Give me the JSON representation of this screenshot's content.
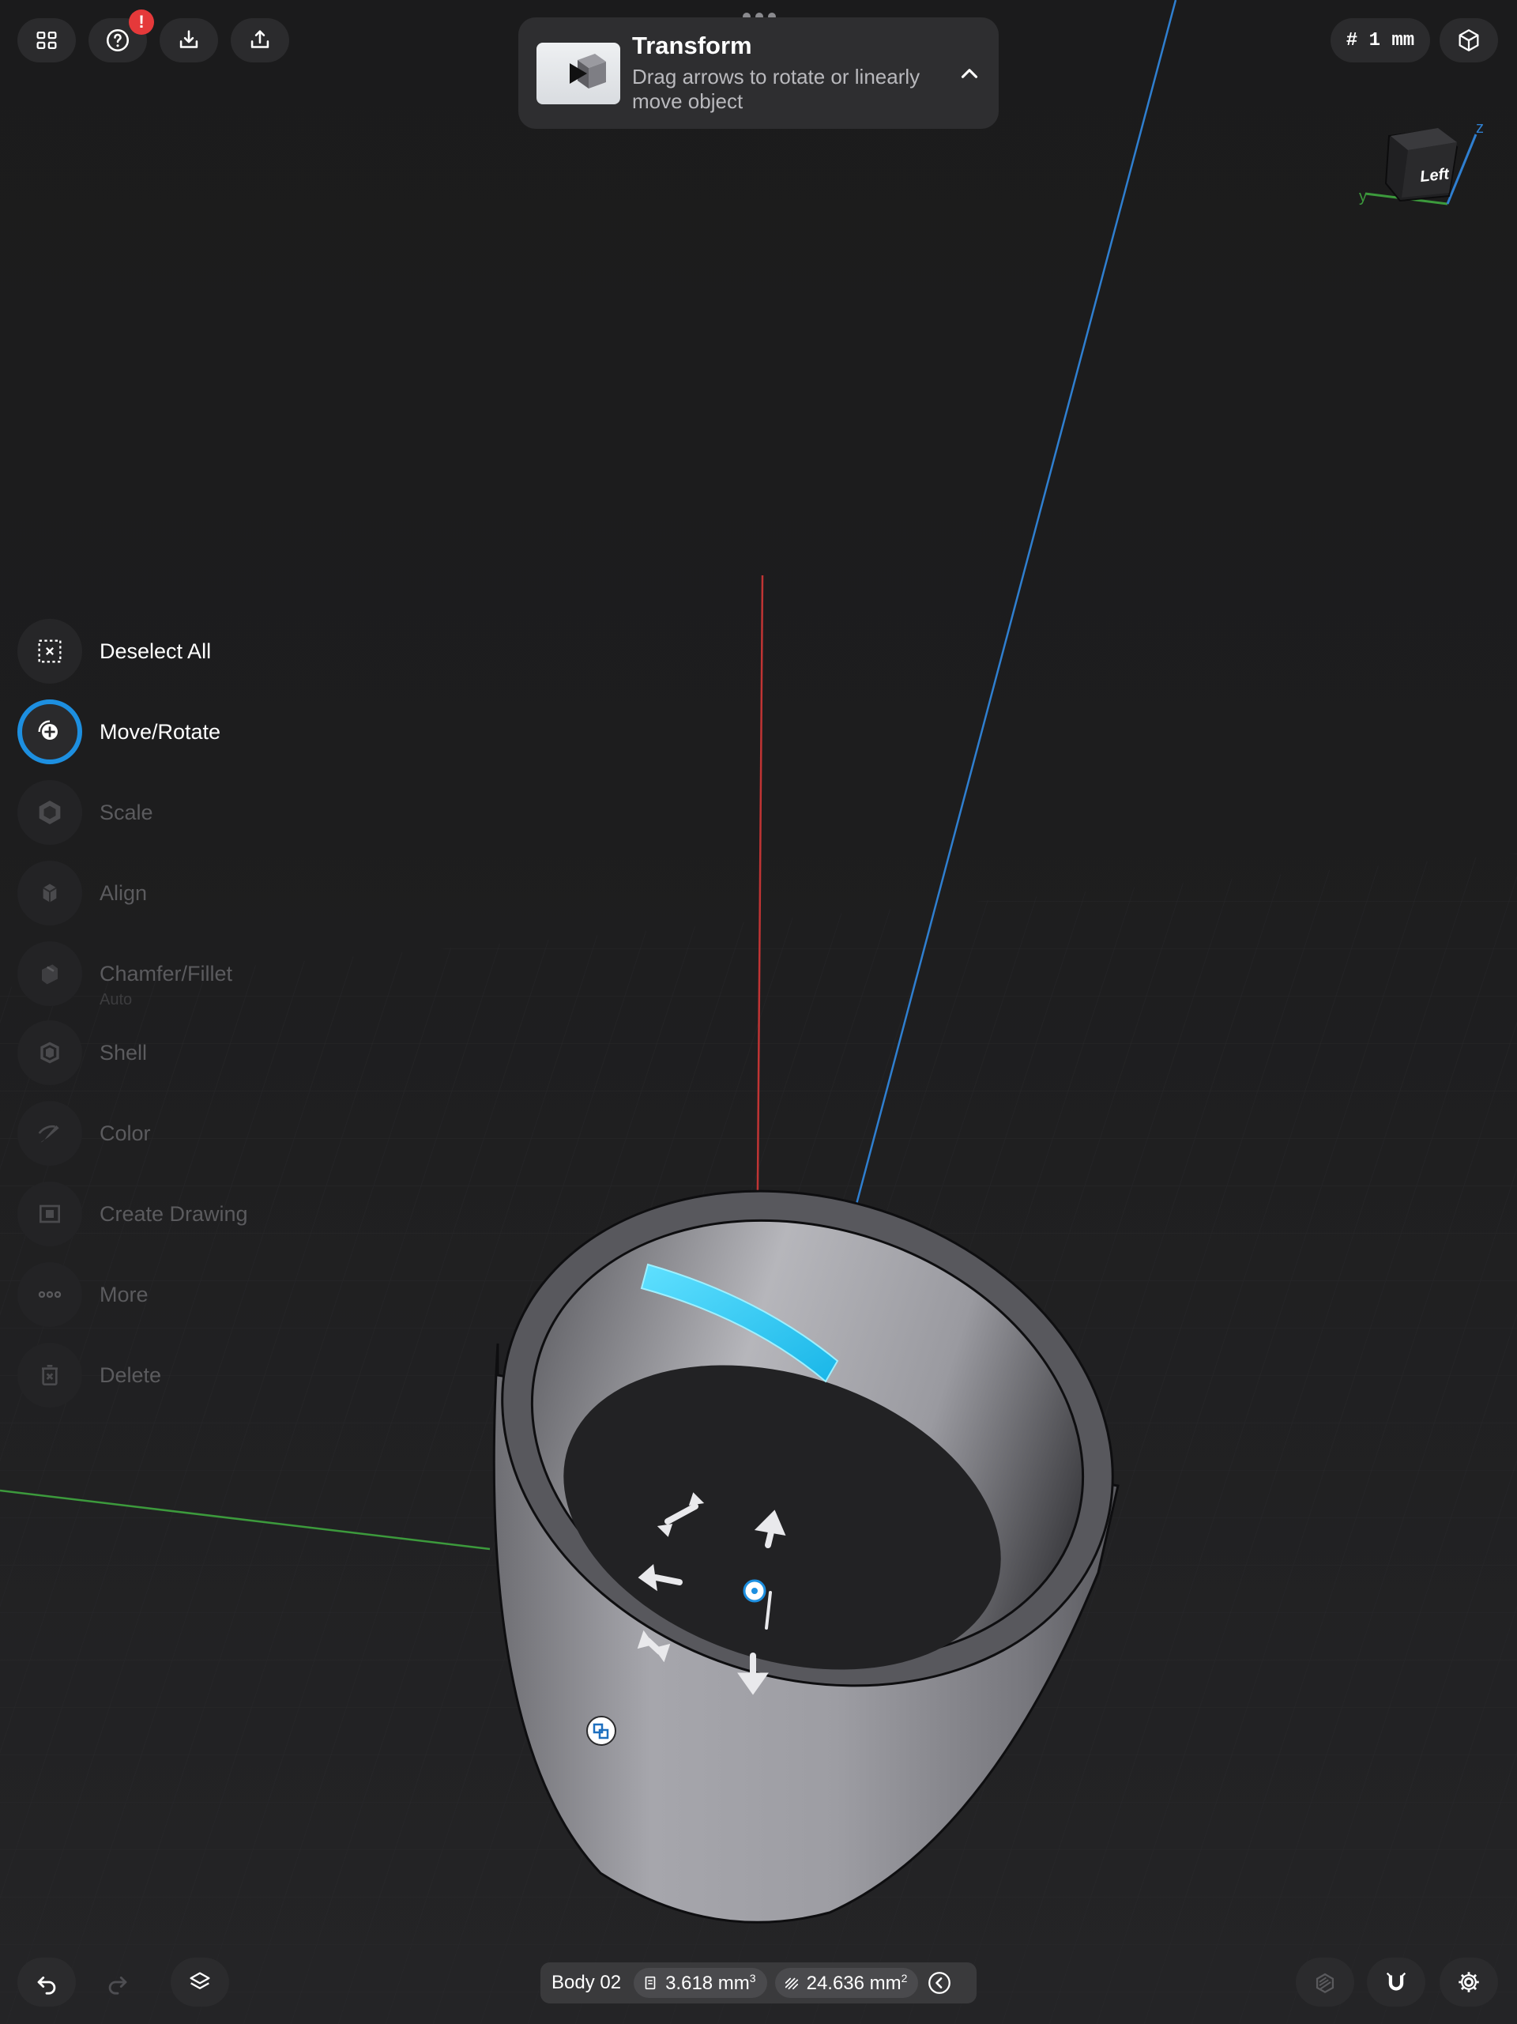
{
  "toolbar": {
    "help_badge": "!",
    "units": "# 1 mm"
  },
  "transform_panel": {
    "title": "Transform",
    "subtitle": "Drag arrows to rotate or linearly move object"
  },
  "view_cube": {
    "face_label": "Left",
    "axis_y": "y",
    "axis_z": "z"
  },
  "tools": [
    {
      "label": "Deselect All",
      "enabled": true,
      "active": false
    },
    {
      "label": "Move/Rotate",
      "enabled": true,
      "active": true
    },
    {
      "label": "Scale",
      "enabled": false
    },
    {
      "label": "Align",
      "enabled": false
    },
    {
      "label": "Chamfer/Fillet",
      "sublabel": "Auto",
      "enabled": false
    },
    {
      "label": "Shell",
      "enabled": false
    },
    {
      "label": "Color",
      "enabled": false
    },
    {
      "label": "Create Drawing",
      "enabled": false
    },
    {
      "label": "More",
      "enabled": false
    },
    {
      "label": "Delete",
      "enabled": false
    }
  ],
  "status": {
    "body_name": "Body 02",
    "volume": "3.618 mm",
    "volume_unit_exp": "3",
    "area": "24.636 mm",
    "area_unit_exp": "2"
  },
  "colors": {
    "accent": "#1d8fe0",
    "selection": "#29c8f0",
    "x_axis": "#c03434",
    "y_axis": "#3c9a3c",
    "z_axis": "#2f7fd0"
  }
}
